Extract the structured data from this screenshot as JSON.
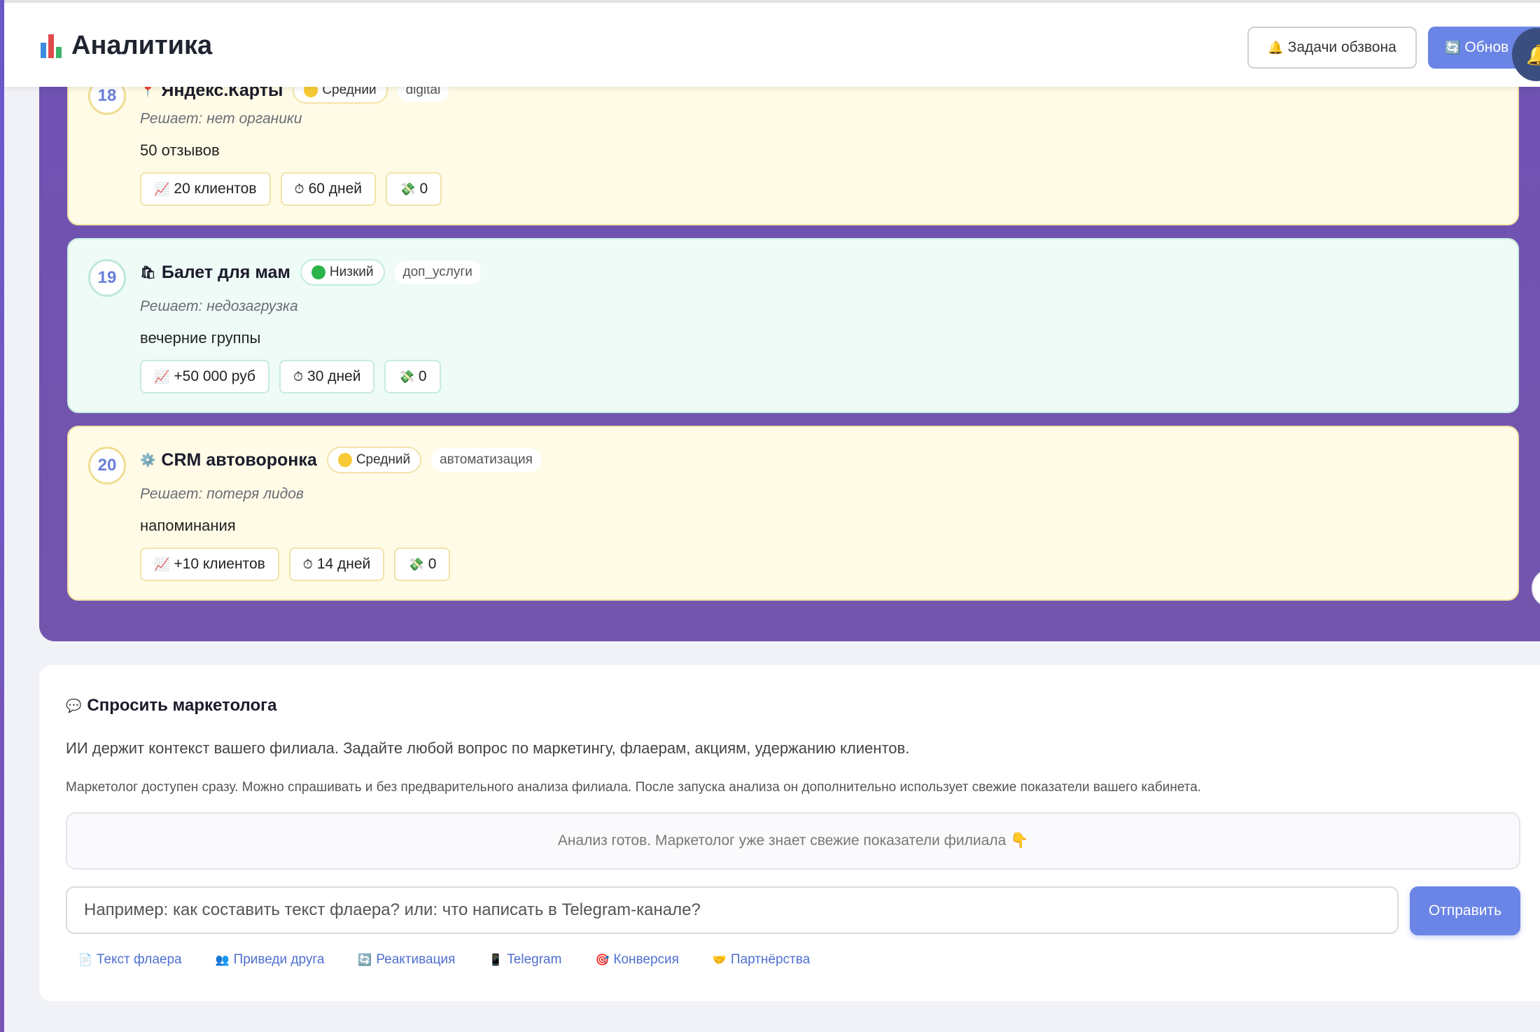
{
  "header": {
    "title": "Аналитика",
    "tasks_button": "Задачи обзвона",
    "refresh_button": "Обнов"
  },
  "recommendations": [
    {
      "num": "18",
      "title": "Яндекс.Карты",
      "priority": "Средний",
      "priority_color": "#f7c934",
      "category": "digital",
      "solves": "Решает: нет органики",
      "detail": "50 отзывов",
      "metrics": {
        "effect": "20 клиентов",
        "time": "60 дней",
        "cost": "0"
      }
    },
    {
      "num": "19",
      "title": "Балет для мам",
      "priority": "Низкий",
      "priority_color": "#2cb34a",
      "category": "доп_услуги",
      "solves": "Решает: недозагрузка",
      "detail": "вечерние группы",
      "metrics": {
        "effect": "+50 000 руб",
        "time": "30 дней",
        "cost": "0"
      }
    },
    {
      "num": "20",
      "title": "CRM автоворонка",
      "priority": "Средний",
      "priority_color": "#f7c934",
      "category": "автоматизация",
      "solves": "Решает: потеря лидов",
      "detail": "напоминания",
      "metrics": {
        "effect": "+10 клиентов",
        "time": "14 дней",
        "cost": "0"
      }
    }
  ],
  "marketer": {
    "title": "Спросить маркетолога",
    "description": "ИИ держит контекст вашего филиала. Задайте любой вопрос по маркетингу, флаерам, акциям, удержанию клиентов.",
    "note": "Маркетолог доступен сразу. Можно спрашивать и без предварительного анализа филиала. После запуска анализа он дополнительно использует свежие показатели вашего кабинета.",
    "status": "Анализ готов. Маркетолог уже знает свежие показатели филиала 👇",
    "input_placeholder": "Например: как составить текст флаера? или: что написать в Telegram-канале?",
    "send_button": "Отправить",
    "chips": [
      {
        "icon": "📄",
        "label": "Текст флаера"
      },
      {
        "icon": "👥",
        "label": "Приведи друга"
      },
      {
        "icon": "🔄",
        "label": "Реактивация"
      },
      {
        "icon": "📱",
        "label": "Telegram"
      },
      {
        "icon": "🎯",
        "label": "Конверсия"
      },
      {
        "icon": "🤝",
        "label": "Партнёрства"
      }
    ]
  },
  "colors": {
    "accent": "#6b85e6",
    "panel_purple": "#7355ad",
    "card_yellow": "#fffbe6",
    "card_green": "#eefbf6"
  }
}
